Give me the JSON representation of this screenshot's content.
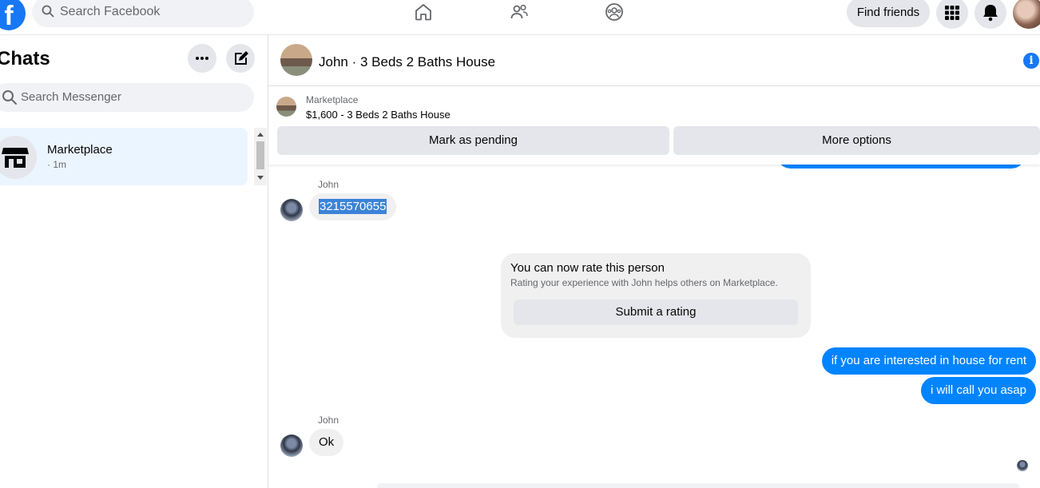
{
  "topbar": {
    "logo": "f",
    "search_placeholder": "Search Facebook",
    "nav_icons": [
      "home-icon",
      "friends-icon",
      "groups-icon"
    ],
    "find_friends": "Find friends",
    "menu_icon": "grid-menu-icon",
    "notifications_icon": "bell-icon"
  },
  "sidebar": {
    "title": "Chats",
    "search_placeholder": "Search Messenger",
    "chats": [
      {
        "name": "Marketplace",
        "time": "· 1m"
      }
    ]
  },
  "conversation": {
    "title": "John · 3 Beds 2 Baths House",
    "marketplace": {
      "label": "Marketplace",
      "listing": "$1,600 - 3 Beds 2 Baths House",
      "mark_pending": "Mark as pending",
      "more_options": "More options"
    },
    "messages": {
      "sender1": "John",
      "msg1": "3215570655",
      "rate_title": "You can now rate this person",
      "rate_sub": "Rating your experience with John helps others on Marketplace.",
      "rate_button": "Submit a rating",
      "out1": "if you are interested in house for rent",
      "out2": "i will call you asap",
      "sender2": "John",
      "msg2": "Ok"
    }
  },
  "colors": {
    "accent": "#1877f2",
    "outgoing_bubble": "#0084ff",
    "incoming_bubble": "#f0f0f0"
  }
}
